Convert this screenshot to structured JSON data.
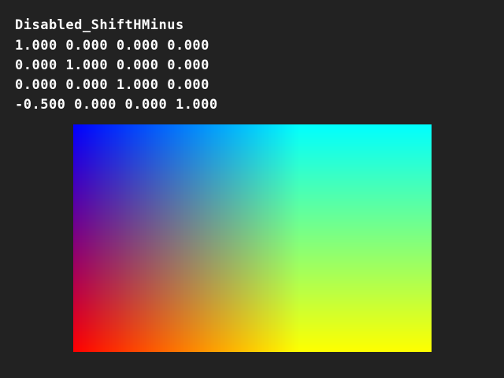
{
  "title": "Disabled_ShiftHMinus",
  "matrix_rows": [
    "1.000 0.000 0.000 0.000",
    "0.000 1.000 0.000 0.000",
    "0.000 0.000 1.000 0.000",
    "-0.500 0.000 0.000 1.000"
  ],
  "gradient_corners": {
    "top_left": "#0000ff",
    "top_right": "#00ffff",
    "bottom_left": "#ff0000",
    "bottom_right": "#ffff00"
  }
}
